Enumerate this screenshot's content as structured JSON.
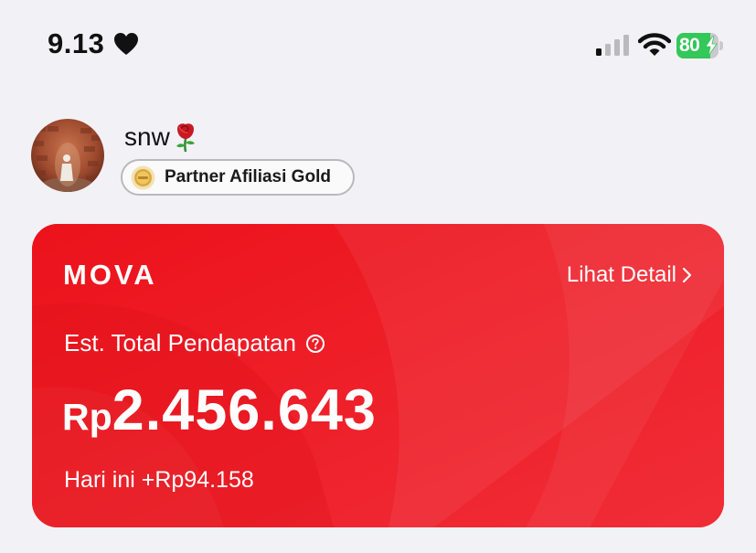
{
  "status_bar": {
    "time": "9.13",
    "battery_level": "80",
    "battery_fraction": 0.8,
    "icons": [
      "heart-icon",
      "cellular-signal-icon",
      "wifi-icon",
      "battery-charging-icon"
    ]
  },
  "profile": {
    "username": "snw",
    "username_emoji": "rose-icon",
    "badge_label": "Partner Afiliasi Gold",
    "badge_icon": "gold-medal-icon"
  },
  "earnings_card": {
    "brand": "MOVA",
    "detail_link": "Lihat Detail",
    "total_label": "Est. Total Pendapatan",
    "currency": "Rp",
    "amount": "2.456.643",
    "today_text": "Hari ini +Rp94.158",
    "colors": {
      "background": "#ee1c25",
      "text": "#ffffff"
    }
  }
}
